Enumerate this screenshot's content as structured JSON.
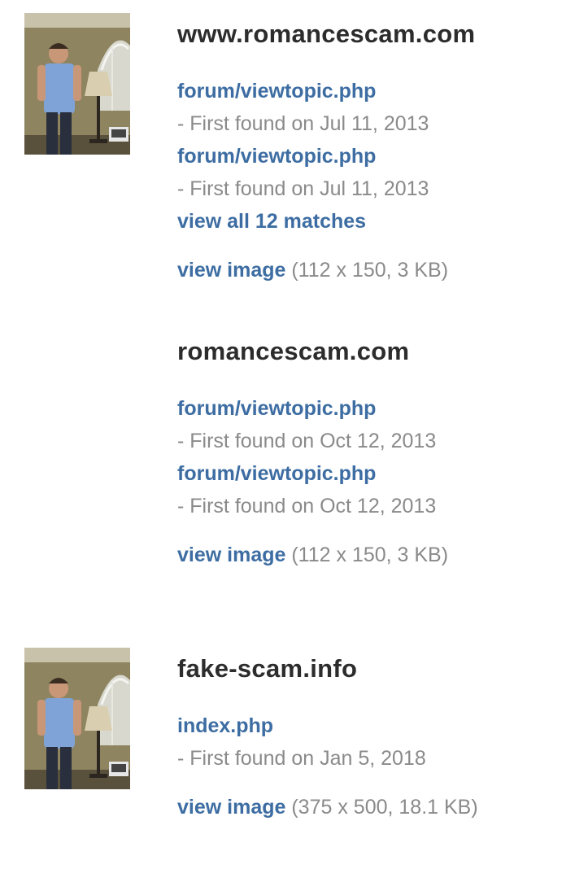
{
  "results": [
    {
      "has_thumbnail": true,
      "domain": "www.romancescam.com",
      "matches": [
        {
          "link": "forum/viewtopic.php",
          "date": "- First found on Jul 11, 2013"
        },
        {
          "link": "forum/viewtopic.php",
          "date": "- First found on Jul 11, 2013"
        }
      ],
      "view_all": "view all 12 matches",
      "view_image_label": "view image",
      "image_meta": "(112 x 150, 3 KB)"
    },
    {
      "has_thumbnail": false,
      "domain": "romancescam.com",
      "matches": [
        {
          "link": "forum/viewtopic.php",
          "date": "- First found on Oct 12, 2013"
        },
        {
          "link": "forum/viewtopic.php",
          "date": "- First found on Oct 12, 2013"
        }
      ],
      "view_image_label": "view image",
      "image_meta": "(112 x 150, 3 KB)"
    },
    {
      "has_thumbnail": true,
      "domain": "fake-scam.info",
      "matches": [
        {
          "link": "index.php",
          "date": "- First found on Jan 5, 2018"
        }
      ],
      "view_image_label": "view image",
      "image_meta": "(375 x 500, 18.1 KB)"
    }
  ],
  "icons": {
    "thumbnail": "person-photo-thumbnail"
  }
}
